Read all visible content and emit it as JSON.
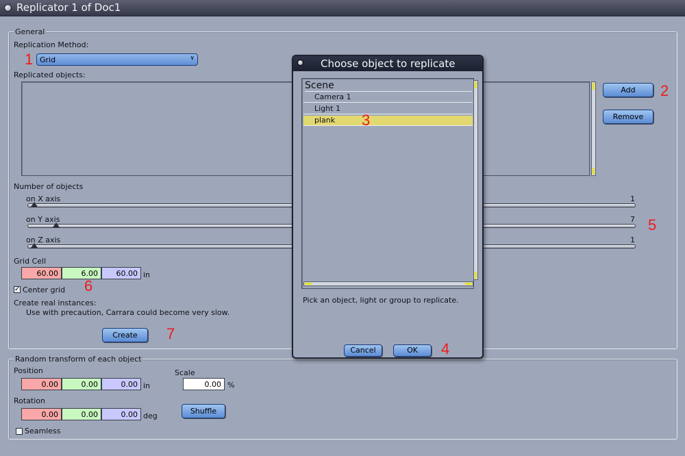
{
  "window": {
    "title": "Replicator 1 of Doc1"
  },
  "general": {
    "legend": "General",
    "replication_method_label": "Replication Method:",
    "replication_method_value": "Grid",
    "replicated_objects_label": "Replicated objects:",
    "add_label": "Add",
    "remove_label": "Remove",
    "number_of_objects_label": "Number of objects",
    "axes": [
      {
        "label": "on X axis",
        "value": "1",
        "level": 0.0
      },
      {
        "label": "on Y axis",
        "value": "7",
        "level": 0.04
      },
      {
        "label": "on Z axis",
        "value": "1",
        "level": 0.0
      }
    ],
    "grid_cell_label": "Grid Cell",
    "grid_cell": {
      "x": "60.00",
      "y": "6.00",
      "z": "60.00",
      "unit": "in"
    },
    "center_grid_label": "Center grid",
    "center_grid_checked": true,
    "create_instances_label": "Create real instances:",
    "create_instances_note": "Use with precaution, Carrara could become very slow.",
    "create_label": "Create"
  },
  "random_transform": {
    "legend": "Random transform of each object",
    "position_label": "Position",
    "position": {
      "x": "0.00",
      "y": "0.00",
      "z": "0.00",
      "unit": "in"
    },
    "rotation_label": "Rotation",
    "rotation": {
      "x": "0.00",
      "y": "0.00",
      "z": "0.00",
      "unit": "deg"
    },
    "scale_label": "Scale",
    "scale_value": "0.00",
    "scale_unit": "%",
    "shuffle_label": "Shuffle",
    "seamless_label": "Seamless",
    "seamless_checked": false
  },
  "dialog": {
    "title": "Choose object to replicate",
    "tree_root": "Scene",
    "items": [
      {
        "label": "Camera 1",
        "selected": false
      },
      {
        "label": "Light 1",
        "selected": false
      },
      {
        "label": "plank",
        "selected": true
      }
    ],
    "hint": "Pick an object, light or group to replicate.",
    "cancel_label": "Cancel",
    "ok_label": "OK"
  },
  "annotations": [
    "1",
    "2",
    "3",
    "4",
    "5",
    "6",
    "7"
  ],
  "colors": {
    "background": "#9ea7b9",
    "button": "#6f9ade",
    "selection": "#e2d870",
    "annotation": "#ee1a1a",
    "field_x": "#f8a8a8",
    "field_y": "#c8f8c0",
    "field_z": "#c8c8ff"
  }
}
